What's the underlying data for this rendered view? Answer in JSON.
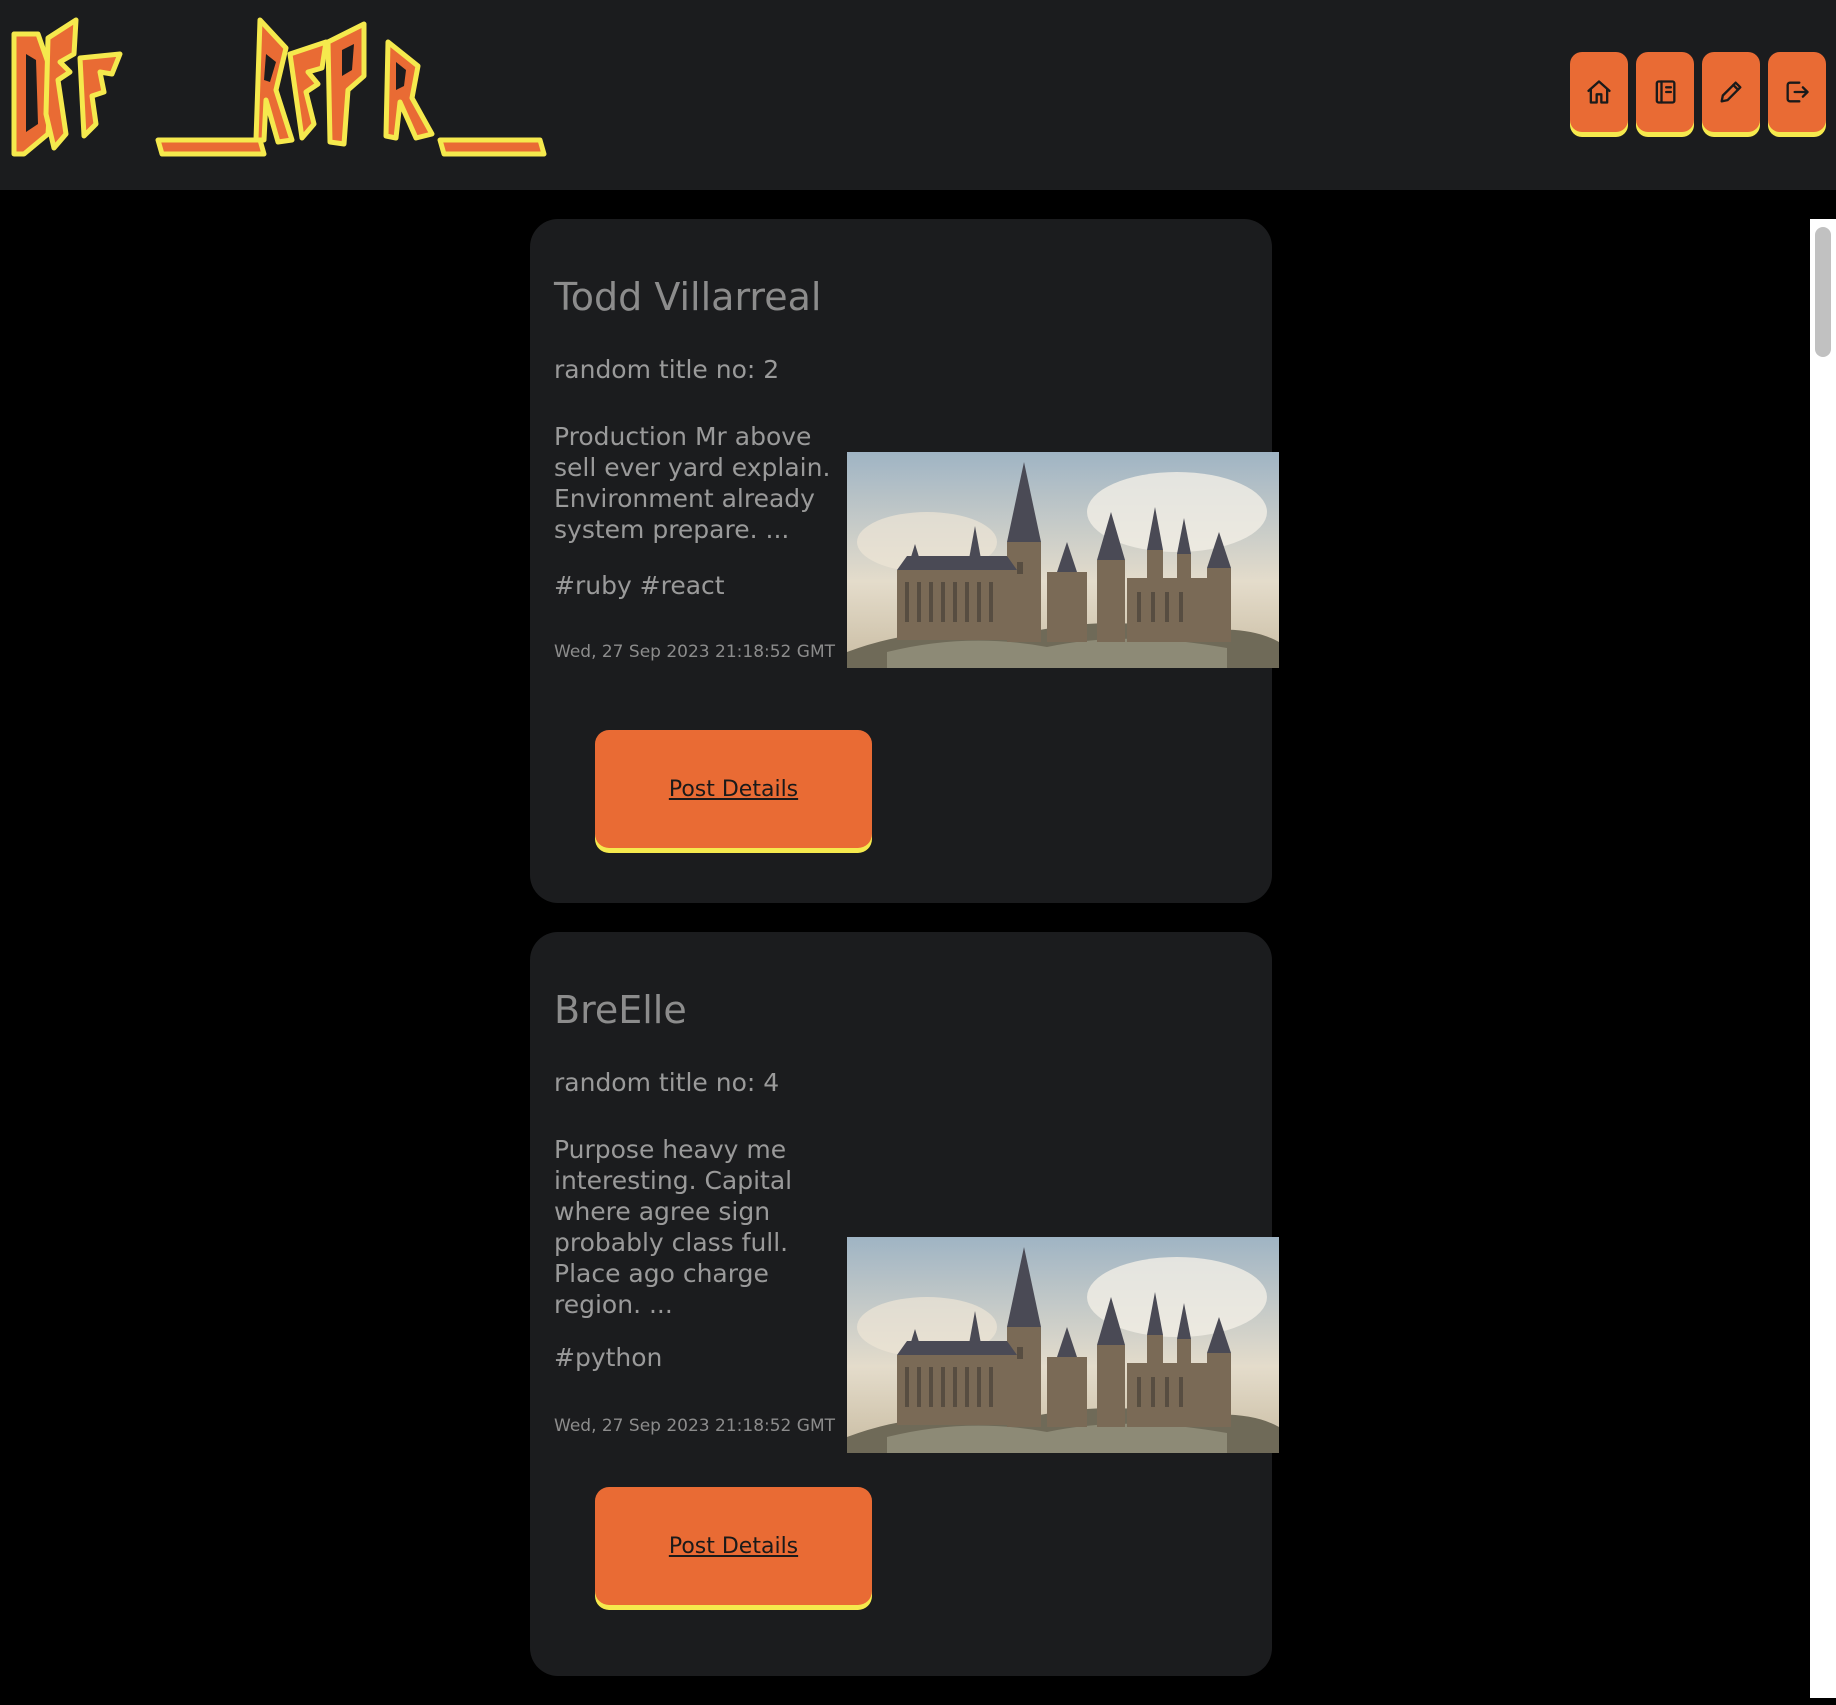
{
  "logo": {
    "text": "DEF __REPR__"
  },
  "nav": {
    "items": [
      {
        "icon": "home-icon",
        "label": "Home"
      },
      {
        "icon": "notebook-icon",
        "label": "Posts"
      },
      {
        "icon": "pencil-icon",
        "label": "Create"
      },
      {
        "icon": "logout-icon",
        "label": "Logout"
      }
    ]
  },
  "colors": {
    "accent": "#e96b34",
    "accent_shadow": "#f5e94d",
    "card_bg": "#1b1c1e",
    "page_bg": "#000000",
    "text": "#9a9a9a"
  },
  "posts": [
    {
      "author": "Todd Villarreal",
      "title": "random title no: 2",
      "body": "Production Mr above sell ever yard explain. Environment already system prepare. ...",
      "tags": "#ruby #react",
      "date": "Wed, 27 Sep 2023 21:18:52 GMT",
      "button": "Post Details"
    },
    {
      "author": "BreElle",
      "title": "random title no: 4",
      "body": "Purpose heavy me interesting. Capital where agree sign probably class full. Place ago charge region. ...",
      "tags": "#python",
      "date": "Wed, 27 Sep 2023 21:18:52 GMT",
      "button": "Post Details"
    }
  ]
}
